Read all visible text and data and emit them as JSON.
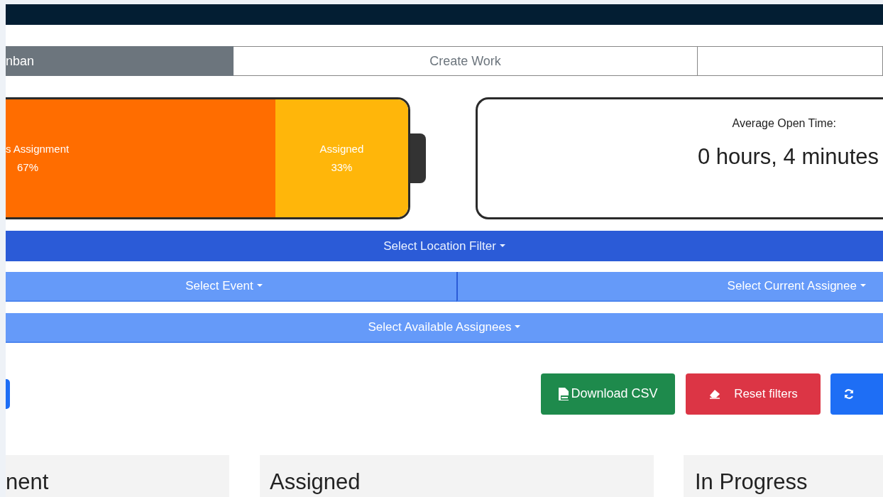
{
  "tabs": [
    {
      "label": "nban",
      "selected": true
    },
    {
      "label": "Create Work",
      "selected": false
    },
    {
      "selected": false
    }
  ],
  "status_battery": {
    "segments": [
      {
        "label": "s Assignment",
        "percent": "67%",
        "level": 0.67,
        "color": "#ff6d00"
      },
      {
        "label": "Assigned",
        "percent": "33%",
        "level": 0.33,
        "color": "#ffb60a"
      }
    ]
  },
  "open_time": {
    "title": "Average Open Time:",
    "value": "0 hours, 4 minutes"
  },
  "filters": [
    {
      "kind": "primary",
      "label": "Select Location Filter"
    },
    {
      "kind": "secondary",
      "label": "Select Event"
    },
    {
      "kind": "secondary",
      "label": "Select Current Assignee"
    },
    {
      "kind": "wide",
      "label": "Select Available Assignees"
    }
  ],
  "actions": [
    {
      "kind": "csv",
      "label": "Download CSV"
    },
    {
      "kind": "reset",
      "label": "Reset filters"
    },
    {
      "kind": "refresh"
    }
  ],
  "columns": [
    {
      "title": "nent"
    },
    {
      "title": "Assigned"
    },
    {
      "title": "In Progress"
    }
  ]
}
